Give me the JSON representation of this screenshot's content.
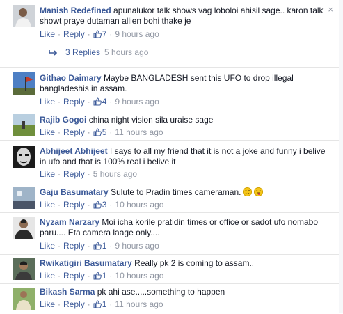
{
  "actions": {
    "like": "Like",
    "reply": "Reply",
    "sep": "·"
  },
  "comments": [
    {
      "author": "Manish Redefined",
      "text": "apunalukor talk shows vag loboloi ahisil sage.. karon talk showt praye dutaman allien bohi thake je",
      "likes": "7",
      "time": "9 hours ago",
      "close": "×",
      "avatar_icon": "person-white-shirt"
    },
    {
      "author": "Githao Daimary",
      "text": "Maybe BANGLADESH sent this UFO to drop illegal bangladeshis in assam.",
      "likes": "4",
      "time": "9 hours ago",
      "avatar_icon": "blue-sky-flag"
    },
    {
      "author": "Rajib Gogoi",
      "text": "china night vision sila uraise sage",
      "likes": "5",
      "time": "11 hours ago",
      "avatar_icon": "green-field"
    },
    {
      "author": "Abhijeet Abhijeet",
      "text": "I says to all my friend that it is not a joke and funny i belive in ufo and that is 100% real i belive it",
      "time": "5 hours ago",
      "avatar_icon": "bw-face"
    },
    {
      "author": "Gaju Basumatary",
      "text": "Sulute to Pradin times cameraman.",
      "likes": "3",
      "time": "10 hours ago",
      "avatar_icon": "sky-landscape",
      "emojis": [
        "wink-emoji",
        "tongue-emoji"
      ]
    },
    {
      "author": "Nyzam Narzary",
      "text": "Moi icha korile pratidin times or office or sadot ufo nomabo paru.... Eta camera laage only....",
      "likes": "1",
      "time": "9 hours ago",
      "avatar_icon": "man-dark-shirt"
    },
    {
      "author": "Rwikatigiri Basumatary",
      "text": "Really pk 2 is coming to assam..",
      "likes": "1",
      "time": "10 hours ago",
      "avatar_icon": "man-portrait"
    },
    {
      "author": "Bikash Sarma",
      "text": "pk ahi ase.....something to happen",
      "likes": "1",
      "time": "11 hours ago",
      "avatar_icon": "man-outdoor"
    }
  ],
  "replies": {
    "label": "3 Replies",
    "time": "5 hours ago"
  },
  "colors": {
    "link": "#3b5998",
    "meta": "#9197a3",
    "divider": "#e5e5e5"
  }
}
